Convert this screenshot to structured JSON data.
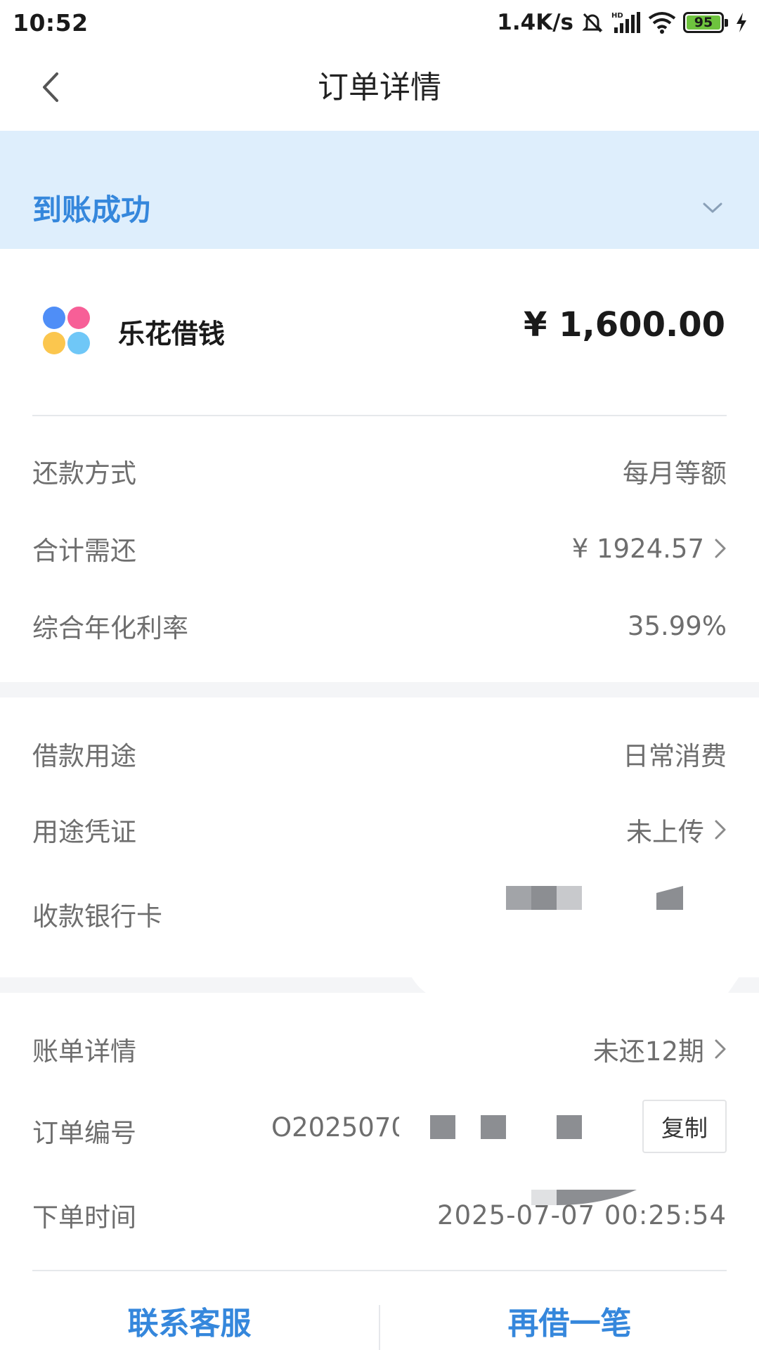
{
  "status_bar": {
    "time": "10:52",
    "network_speed": "1.4K/s",
    "battery": "95",
    "icons": [
      "mute-bell-icon",
      "hd-signal-icon",
      "wifi-icon",
      "battery-icon",
      "charging-icon"
    ]
  },
  "nav": {
    "title": "订单详情",
    "back_icon": "chevron-left-icon"
  },
  "banner": {
    "status": "到账成功",
    "expand_icon": "chevron-down-icon"
  },
  "product": {
    "name": "乐花借钱",
    "amount": "¥ 1,600.00",
    "logo_colors": [
      "#4f8ef7",
      "#f75f97",
      "#fbc64e",
      "#6fc7f7"
    ]
  },
  "loan_info": {
    "repay_method": {
      "label": "还款方式",
      "value": "每月等额"
    },
    "total_due": {
      "label": "合计需还",
      "value": "¥ 1924.57"
    },
    "annual_rate": {
      "label": "综合年化利率",
      "value": "35.99%"
    }
  },
  "purpose_info": {
    "purpose": {
      "label": "借款用途",
      "value": "日常消费"
    },
    "proof": {
      "label": "用途凭证",
      "value": "未上传"
    },
    "bank_card": {
      "label": "收款银行卡"
    }
  },
  "order_info": {
    "bill_detail": {
      "label": "账单详情",
      "value": "未还12期"
    },
    "order_no": {
      "label": "订单编号",
      "value": "O2025070",
      "copy_label": "复制"
    },
    "order_time": {
      "label": "下单时间",
      "value": "2025-07-07 00:25:54"
    }
  },
  "actions": {
    "contact": "联系客服",
    "borrow_again": "再借一笔"
  },
  "colors": {
    "accent": "#3587dc",
    "banner_bg": "#deeefc",
    "muted_text": "#6e6e6e",
    "section_bg": "#f4f5f7"
  }
}
